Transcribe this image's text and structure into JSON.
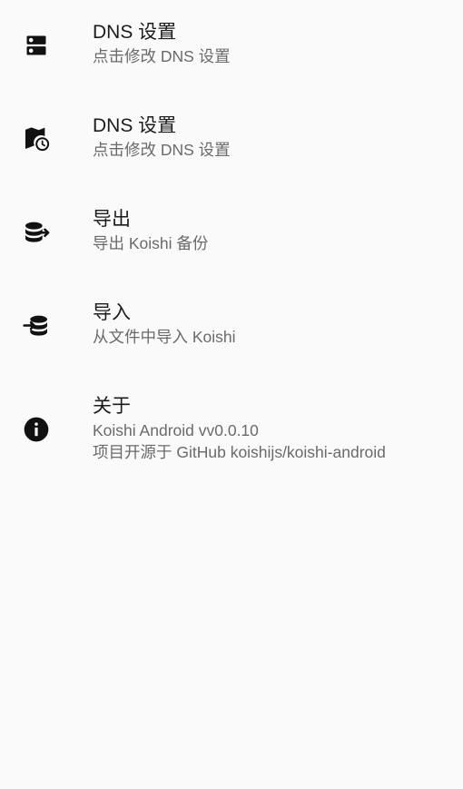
{
  "settings": {
    "items": [
      {
        "icon": "dns-server-icon",
        "title": "DNS 设置",
        "subtitle": "点击修改 DNS 设置"
      },
      {
        "icon": "map-clock-icon",
        "title": "DNS 设置",
        "subtitle": "点击修改 DNS 设置"
      },
      {
        "icon": "database-export-icon",
        "title": "导出",
        "subtitle": "导出 Koishi 备份"
      },
      {
        "icon": "database-import-icon",
        "title": "导入",
        "subtitle": "从文件中导入 Koishi"
      },
      {
        "icon": "info-icon",
        "title": "关于",
        "subtitle": "Koishi Android vv0.0.10",
        "subtitle2": "项目开源于 GitHub koishijs/koishi-android"
      }
    ]
  }
}
